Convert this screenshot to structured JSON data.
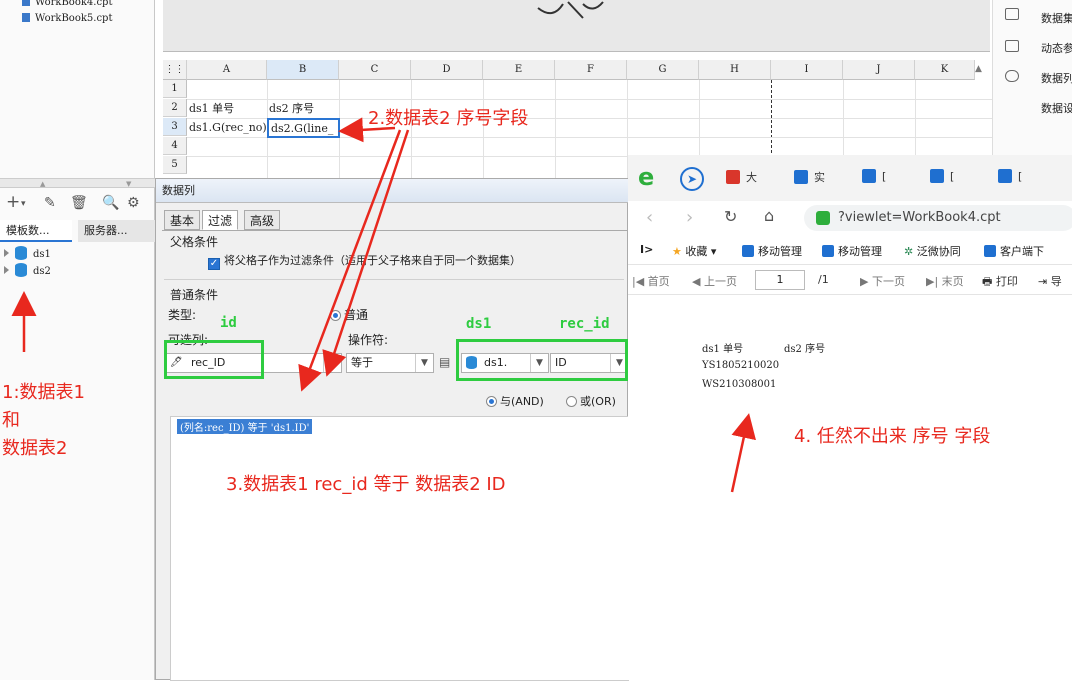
{
  "left_panel": {
    "files": [
      "WorkBook4.cpt",
      "WorkBook5.cpt"
    ],
    "tabs": [
      "模板数...",
      "服务器..."
    ],
    "datasets": [
      "ds1",
      "ds2"
    ]
  },
  "sheet": {
    "columns": [
      "A",
      "B",
      "C",
      "D",
      "E",
      "F",
      "G",
      "H",
      "I",
      "J",
      "K"
    ],
    "rows": [
      "1",
      "2",
      "3",
      "4",
      "5"
    ],
    "cells": {
      "A2": "ds1 单号",
      "B2": "ds2 序号",
      "A3": "ds1.G(rec_no)",
      "B3": "ds2.G(line_"
    }
  },
  "right_panel": [
    "数据集",
    "动态参",
    "数据列",
    "数据设"
  ],
  "dialog": {
    "title": "数据列",
    "tabs": [
      "基本",
      "过滤",
      "高级"
    ],
    "parent_condition_label": "父格条件",
    "parent_checkbox_label": "将父格子作为过滤条件（适用于父子格来自于同一个数据集）",
    "normal_condition_label": "普通条件",
    "type_label": "类型:",
    "type_value": "普通",
    "available_columns_label": "可选列:",
    "operator_label": "操作符:",
    "column_value": "rec_ID",
    "operator_value": "等于",
    "dataset_value": "ds1.",
    "field_value": "ID",
    "and_label": "与(AND)",
    "or_label": "或(OR)",
    "condition_item": "(列名:rec_ID) 等于 'ds1.ID'"
  },
  "annotations": {
    "a1_line1": "1:数据表1",
    "a1_line2": "和",
    "a1_line3": "数据表2",
    "a2": "2.数据表2 序号字段",
    "a3": "3.数据表1 rec_id 等于 数据表2 ID",
    "a4": "4. 任然不出来 序号 字段",
    "green_id": "id",
    "green_ds1": "ds1",
    "green_rec_id": "rec_id"
  },
  "browser": {
    "tabs": [
      "大",
      "实",
      "[",
      "[",
      "["
    ],
    "address": "?viewlet=WorkBook4.cpt",
    "bookmarks": [
      "收藏",
      "移动管理",
      "移动管理",
      "泛微协同",
      "客户端下"
    ],
    "report_toolbar": {
      "first": "首页",
      "prev": "上一页",
      "page": "1",
      "total": "/1",
      "next": "下一页",
      "last": "末页",
      "print": "打印",
      "export": "导"
    },
    "report": {
      "header1": "ds1 单号",
      "header2": "ds2 序号",
      "rows": [
        "YS1805210020",
        "WS210308001"
      ]
    }
  }
}
